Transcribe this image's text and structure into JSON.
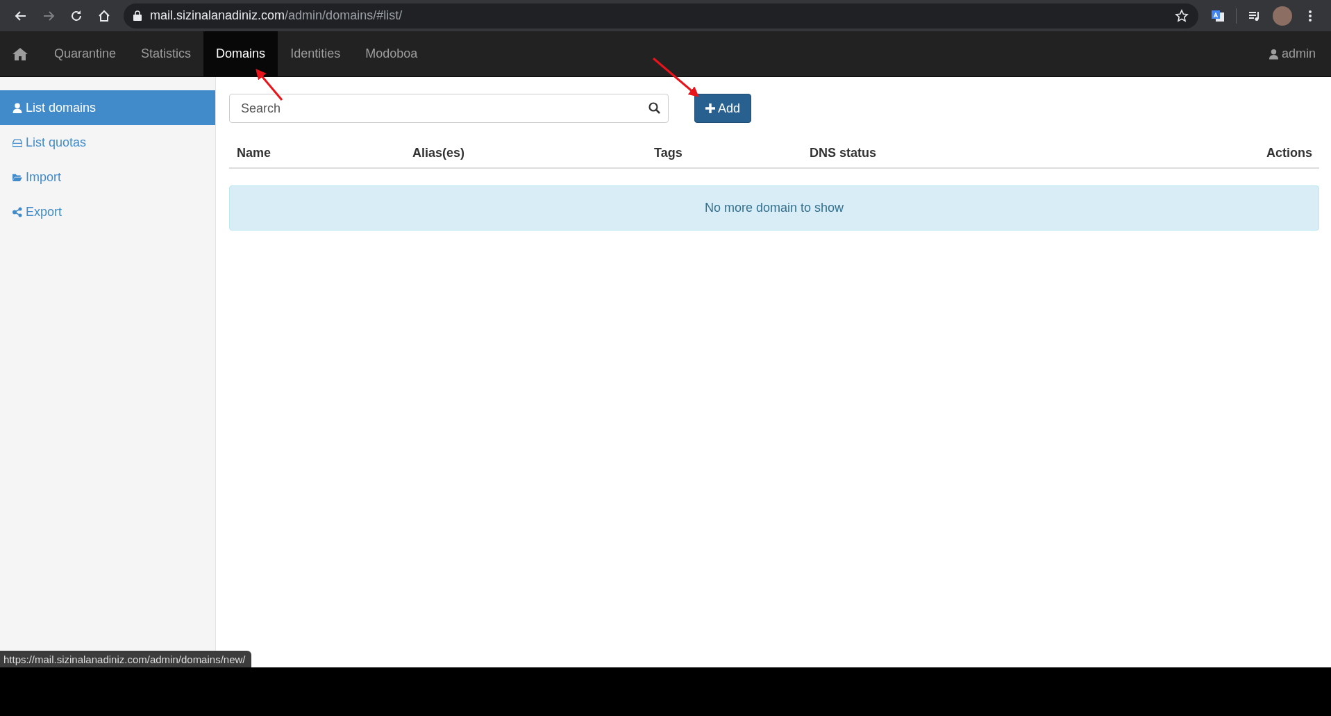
{
  "browser": {
    "url_host": "mail.sizinalanadiniz.com",
    "url_path": "/admin/domains/#list/",
    "status_url": "https://mail.sizinalanadiniz.com/admin/domains/new/"
  },
  "navbar": {
    "items": [
      {
        "label": "Quarantine",
        "selected": false
      },
      {
        "label": "Statistics",
        "selected": false
      },
      {
        "label": "Domains",
        "selected": true
      },
      {
        "label": "Identities",
        "selected": false
      },
      {
        "label": "Modoboa",
        "selected": false
      }
    ],
    "user": "admin"
  },
  "sidebar": {
    "items": [
      {
        "label": "List domains",
        "kind": "user",
        "selected": true
      },
      {
        "label": "List quotas",
        "kind": "drive",
        "selected": false
      },
      {
        "label": "Import",
        "kind": "folder",
        "selected": false
      },
      {
        "label": "Export",
        "kind": "share",
        "selected": false
      }
    ]
  },
  "search": {
    "placeholder": "Search"
  },
  "add_button": {
    "label": "Add"
  },
  "table": {
    "columns": [
      "Name",
      "Alias(es)",
      "Tags",
      "DNS status",
      "Actions"
    ]
  },
  "alert": "No more domain to show"
}
